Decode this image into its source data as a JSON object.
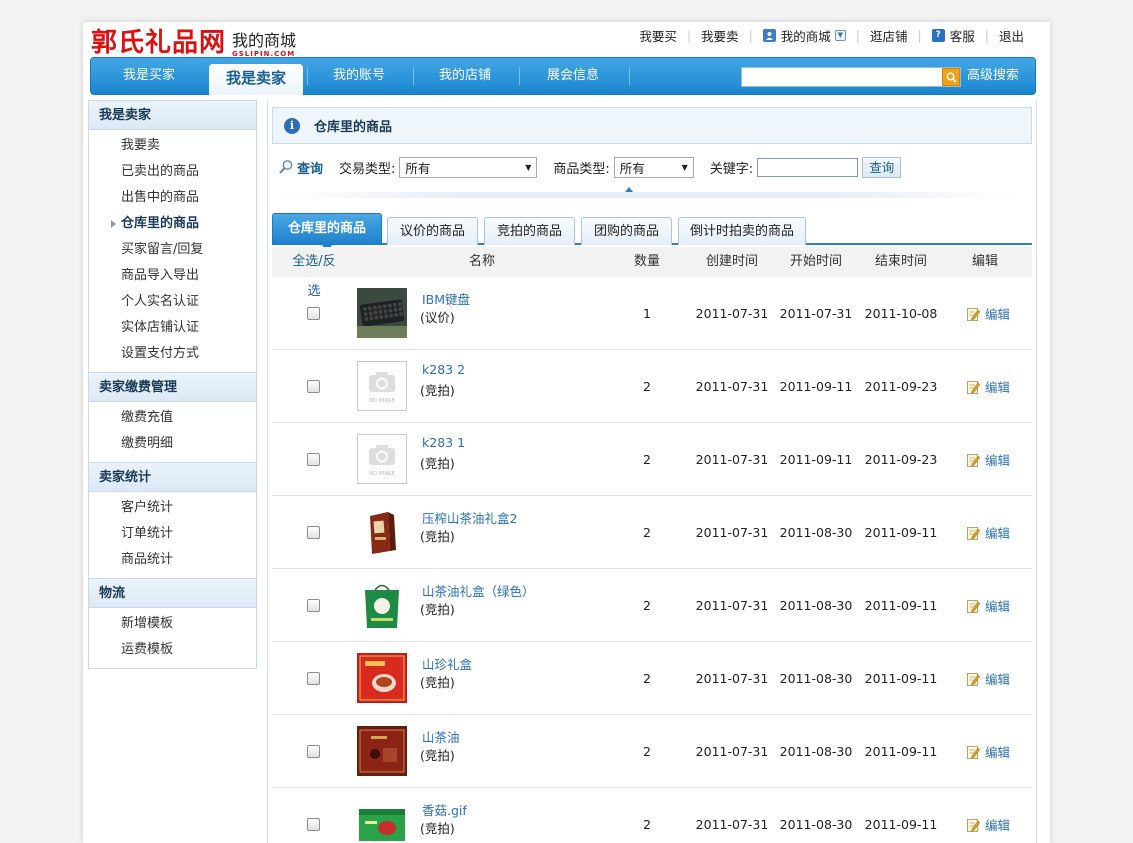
{
  "header": {
    "logo_main": "郭氏礼品网",
    "logo_sub": "我的商城",
    "logo_domain": "GSLIPIN.COM",
    "links": [
      "我要买",
      "我要卖",
      "我的商城",
      "逛店铺",
      "客服",
      "退出"
    ]
  },
  "nav": {
    "tabs": [
      "我是买家",
      "我是卖家",
      "我的账号",
      "我的店铺",
      "展会信息"
    ],
    "active": "我是卖家",
    "search_placeholder": "",
    "advanced_search": "高级搜索"
  },
  "sidebar": [
    {
      "title": "我是卖家",
      "items": [
        "我要卖",
        "已卖出的商品",
        "出售中的商品",
        "仓库里的商品",
        "买家留言/回复",
        "商品导入导出",
        "个人实名认证",
        "实体店铺认证",
        "设置支付方式"
      ]
    },
    {
      "title": "卖家缴费管理",
      "items": [
        "缴费充值",
        "缴费明细"
      ]
    },
    {
      "title": "卖家统计",
      "items": [
        "客户统计",
        "订单统计",
        "商品统计"
      ]
    },
    {
      "title": "物流",
      "items": [
        "新增模板",
        "运费模板"
      ]
    }
  ],
  "sidebar_active": "仓库里的商品",
  "main": {
    "title": "仓库里的商品",
    "filter": {
      "query_label": "查询",
      "trade_type_label": "交易类型:",
      "trade_type_value": "所有",
      "goods_type_label": "商品类型:",
      "goods_type_value": "所有",
      "keyword_label": "关键字:",
      "keyword_value": "",
      "search_button": "查询"
    },
    "tabs": [
      "仓库里的商品",
      "议价的商品",
      "竞拍的商品",
      "团购的商品",
      "倒计时拍卖的商品"
    ],
    "active_tab": "仓库里的商品",
    "columns": {
      "select": "全选/反选",
      "name": "名称",
      "qty": "数量",
      "created": "创建时间",
      "start": "开始时间",
      "end": "结束时间",
      "edit": "编辑"
    },
    "rows": [
      {
        "name": "IBM键盘",
        "type": "(议价)",
        "qty": "1",
        "created": "2011-07-31",
        "start": "2011-07-31",
        "end": "2011-10-08",
        "edit": "编辑",
        "thumb": "keyboard"
      },
      {
        "name": "k283 2",
        "type": "(竞拍)",
        "qty": "2",
        "created": "2011-07-31",
        "start": "2011-09-11",
        "end": "2011-09-23",
        "edit": "编辑",
        "thumb": "noimage",
        "noimage_text": "NO IMAGE"
      },
      {
        "name": "k283 1",
        "type": "(竞拍)",
        "qty": "2",
        "created": "2011-07-31",
        "start": "2011-09-11",
        "end": "2011-09-23",
        "edit": "编辑",
        "thumb": "noimage",
        "noimage_text": "NO IMAGE"
      },
      {
        "name": "压榨山茶油礼盒2",
        "type": "(竞拍)",
        "qty": "2",
        "created": "2011-07-31",
        "start": "2011-08-30",
        "end": "2011-09-11",
        "edit": "编辑",
        "thumb": "box-red"
      },
      {
        "name": "山茶油礼盒（绿色）",
        "type": "(竞拍)",
        "qty": "2",
        "created": "2011-07-31",
        "start": "2011-08-30",
        "end": "2011-09-11",
        "edit": "编辑",
        "thumb": "bag-green"
      },
      {
        "name": "山珍礼盒",
        "type": "(竞拍)",
        "qty": "2",
        "created": "2011-07-31",
        "start": "2011-08-30",
        "end": "2011-09-11",
        "edit": "编辑",
        "thumb": "box-mushroom"
      },
      {
        "name": "山茶油",
        "type": "(竞拍)",
        "qty": "2",
        "created": "2011-07-31",
        "start": "2011-08-30",
        "end": "2011-09-11",
        "edit": "编辑",
        "thumb": "box-dark"
      },
      {
        "name": "香菇.gif",
        "type": "(竞拍)",
        "qty": "2",
        "created": "2011-07-31",
        "start": "2011-08-30",
        "end": "2011-09-11",
        "edit": "编辑",
        "thumb": "box-greenred"
      }
    ]
  }
}
